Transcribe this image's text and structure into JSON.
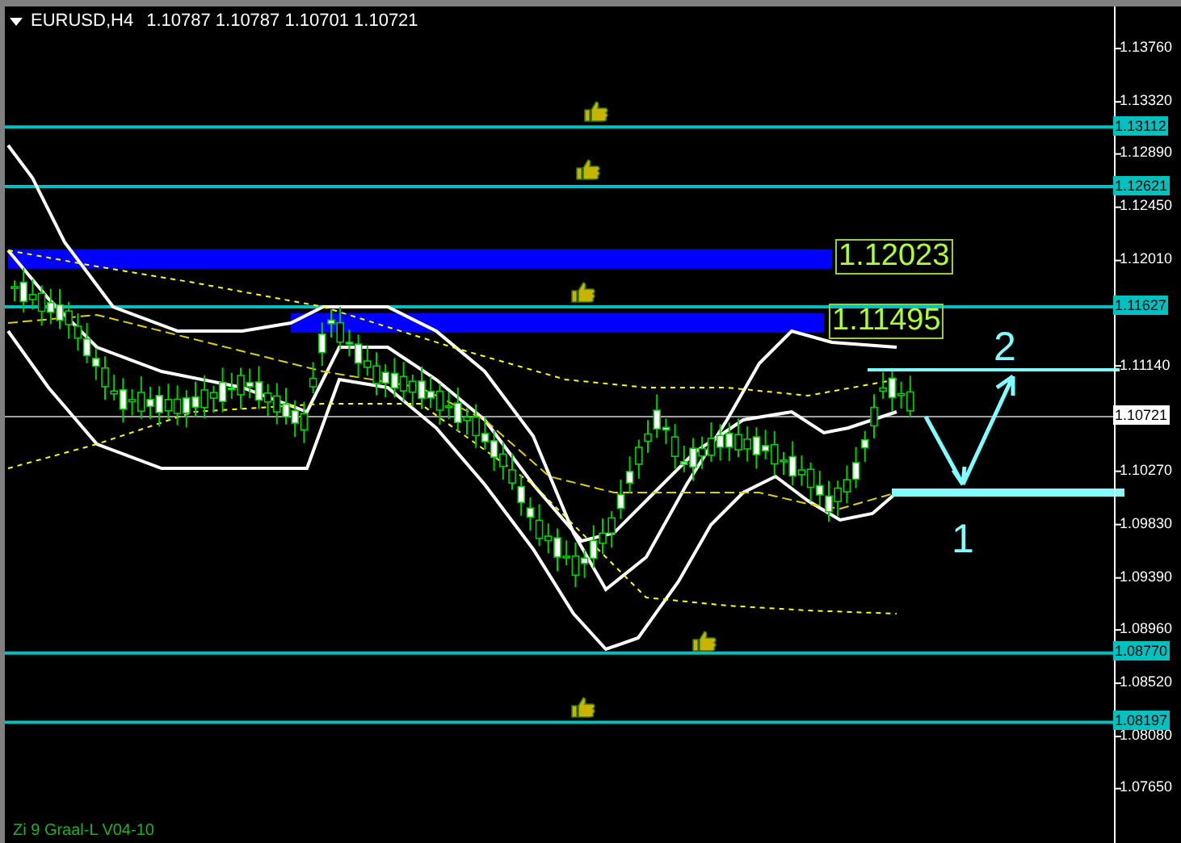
{
  "chart_header": {
    "symbol": "EURUSD,H4",
    "prices": [
      "1.10787",
      "1.10787",
      "1.10701",
      "1.10721"
    ]
  },
  "price_axis": {
    "ticks": [
      "1.13760",
      "1.13320",
      "1.12890",
      "1.12450",
      "1.12010",
      "1.11140",
      "1.10270",
      "1.09830",
      "1.09390",
      "1.08960",
      "1.08520",
      "1.08080",
      "1.07650"
    ]
  },
  "levels": [
    {
      "kind": "level",
      "label": "1.13112"
    },
    {
      "kind": "level",
      "label": "1.12621"
    },
    {
      "kind": "level",
      "label": "1.11627"
    },
    {
      "kind": "current",
      "label": "1.10721"
    },
    {
      "kind": "level",
      "label": "1.08770"
    },
    {
      "kind": "level",
      "label": "1.08197"
    }
  ],
  "zones": [
    {
      "label": "1.12023"
    },
    {
      "label": "1.11495"
    }
  ],
  "wave_labels": [
    {
      "label": "2"
    },
    {
      "label": "1"
    }
  ],
  "footer": "Zi 9 Graal-L V04-10"
}
